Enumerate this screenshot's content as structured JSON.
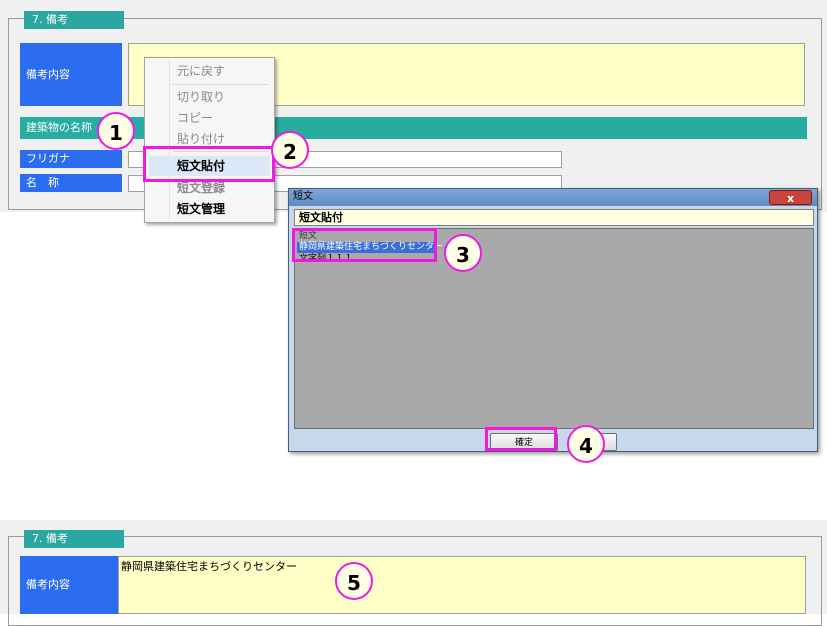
{
  "top_panel": {
    "section_title": "7. 備考",
    "remarks_label": "備考内容",
    "building_label": "建築物の名称",
    "furigana_label": "フリガナ",
    "name_label": "名　称"
  },
  "context_menu": {
    "items": [
      {
        "label": "元に戻す",
        "state": "disabled"
      },
      {
        "label": "切り取り",
        "state": "disabled"
      },
      {
        "label": "コピー",
        "state": "disabled"
      },
      {
        "label": "貼り付け",
        "state": "disabled"
      },
      {
        "label": "短文貼付",
        "state": "highlighted"
      },
      {
        "label": "短文登録",
        "state": "disabled"
      },
      {
        "label": "短文管理",
        "state": "normal"
      }
    ]
  },
  "dialog": {
    "title": "短文",
    "close_label": "x",
    "header": "短文貼付",
    "list_header": "短文",
    "items": [
      "静岡県建築住宅まちづくりセンター",
      "文字列１１１"
    ],
    "selected_index": 0,
    "ok_label": "確定"
  },
  "bottom_panel": {
    "section_title": "7. 備考",
    "remarks_label": "備考内容",
    "remarks_value": "静岡県建築住宅まちづくりセンター"
  },
  "markers": [
    "1",
    "2",
    "3",
    "4",
    "5"
  ],
  "colors": {
    "section_tab": "#2aa7a0",
    "label_blue": "#2b6cf0",
    "field_yellow": "#ffffc8",
    "marker_magenta": "#f019e0"
  }
}
